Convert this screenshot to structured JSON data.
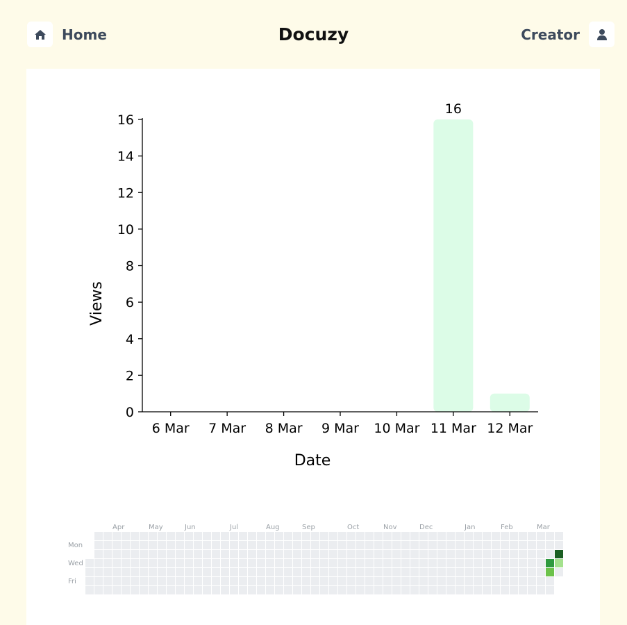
{
  "header": {
    "home_label": "Home",
    "brand": "Docuzy",
    "user_label": "Creator",
    "home_icon": "home-icon",
    "user_icon": "user-icon",
    "icon_color": "#3d4a5c"
  },
  "chart_data": [
    {
      "type": "bar",
      "categories": [
        "6 Mar",
        "7 Mar",
        "8 Mar",
        "9 Mar",
        "10 Mar",
        "11 Mar",
        "12 Mar"
      ],
      "values": [
        0,
        0,
        0,
        0,
        0,
        16,
        1
      ],
      "data_labels": [
        null,
        null,
        null,
        null,
        null,
        "16",
        null
      ],
      "xlabel": "Date",
      "ylabel": "Views",
      "ylim": [
        0,
        16
      ],
      "yticks": [
        "0",
        "2",
        "4",
        "6",
        "8",
        "10",
        "12",
        "14",
        "16"
      ],
      "bar_color": "#dcfce7",
      "grid": false
    },
    {
      "type": "heatmap",
      "months": [
        "Apr",
        "May",
        "Jun",
        "Jul",
        "Aug",
        "Sep",
        "Oct",
        "Nov",
        "Dec",
        "Jan",
        "Feb",
        "Mar"
      ],
      "weekdays": [
        "Mon",
        "Wed",
        "Fri"
      ],
      "weeks": 52,
      "active_cells": [
        {
          "week": 51,
          "day": 3,
          "level": 3
        },
        {
          "week": 51,
          "day": 4,
          "level": 2
        },
        {
          "week": 52,
          "day": 2,
          "level": 4
        },
        {
          "week": 52,
          "day": 3,
          "level": 1
        }
      ],
      "colors": {
        "empty": "#ebedf0",
        "level_1": "#a4e18d",
        "level_2": "#6cc24a",
        "level_3": "#2e9a3e",
        "level_4": "#1a5e22"
      },
      "grid": false
    }
  ]
}
